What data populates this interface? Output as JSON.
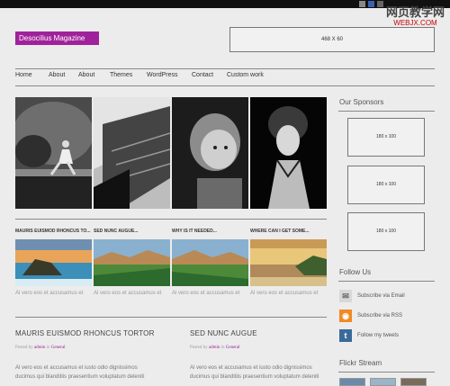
{
  "watermark": {
    "title": "网页教学网",
    "url": "WEBJX.COM"
  },
  "header": {
    "logo": "Desocilius Magazine",
    "ad_banner": "468 X 60"
  },
  "nav": {
    "items": [
      "Home",
      "About",
      "About",
      "Themes",
      "WordPress",
      "Contact",
      "Custom work"
    ]
  },
  "featured_thumbs": [
    {
      "title": "MAURIS EUISMOD RHONCUS TO...",
      "excerpt": "Al vero eos et accusamus et"
    },
    {
      "title": "SED NUNC AUGUE...",
      "excerpt": "Al vero eos et accusamus et"
    },
    {
      "title": "WHY IS IT NEEDED...",
      "excerpt": "Al vero eos et accusamus et"
    },
    {
      "title": "WHERE CAN I GET SOME...",
      "excerpt": "Al vero eos et accusamus et"
    }
  ],
  "posts": [
    {
      "title": "MAURIS EUISMOD RHONCUS TORTOR",
      "meta_prefix": "Posted by",
      "author": "admin",
      "meta_in": "in",
      "category": "General",
      "body": [
        "Al vero eos et accusamus et iusto odio dignissimos",
        "ducimus qui blanditiis praesentium voluptatum deleniti"
      ]
    },
    {
      "title": "SED NUNC AUGUE",
      "meta_prefix": "Posted by",
      "author": "admin",
      "meta_in": "in",
      "category": "General",
      "body": [
        "Al vero eos et accusamus et iusto odio dignissimos",
        "ducimus qui blanditiis praesentium voluptatum deleniti"
      ]
    }
  ],
  "sidebar": {
    "sponsors_heading": "Our Sponsors",
    "ads": [
      "180 x 100",
      "180 x 100",
      "180 x 100"
    ],
    "follow_heading": "Follow Us",
    "follow_items": [
      {
        "icon": "email-icon",
        "label": "Subscribe via Email"
      },
      {
        "icon": "rss-icon",
        "label": "Subscribe via RSS"
      },
      {
        "icon": "twitter-icon",
        "label": "Follow my tweets"
      }
    ],
    "flickr_heading": "Flickr Stream"
  },
  "colors": {
    "brand": "#a0229a",
    "topbar": "#111111",
    "background": "#ececec"
  }
}
